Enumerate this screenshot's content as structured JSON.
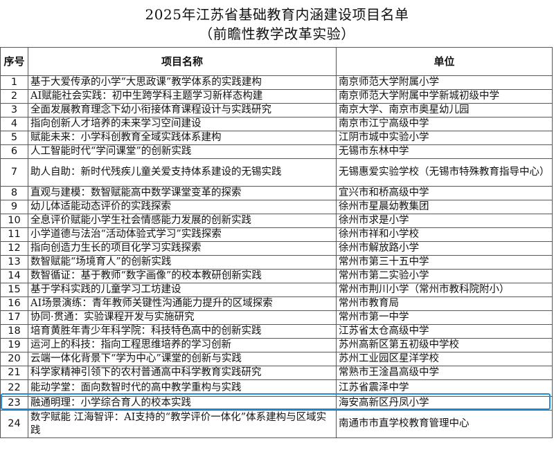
{
  "header": {
    "title": "2025年江苏省基础教育内涵建设项目名单",
    "subtitle": "（前瞻性教学改革实验）"
  },
  "table": {
    "columns": [
      "序号",
      "项目名称",
      "单位"
    ],
    "rows": [
      {
        "no": "1",
        "name": "基于大爱传承的小学“大思政课”教学体系的实践建构",
        "unit": "南京师范大学附属小学"
      },
      {
        "no": "2",
        "name": "AI赋能社会实践：初中生跨学科主题学习新样态构建",
        "unit": "南京师范大学附属中学新城初级中学"
      },
      {
        "no": "3",
        "name": "全面发展教育理念下幼小衔接体育课程设计与实践研究",
        "unit": "南京大学、南京市奥星幼儿园"
      },
      {
        "no": "4",
        "name": "指向创新人才培养的未来学习空间建设",
        "unit": "南京市江宁高级中学"
      },
      {
        "no": "5",
        "name": "赋能未来：小学科创教育全域实践体系建构",
        "unit": "江阴市城中实验小学"
      },
      {
        "no": "6",
        "name": "人工智能时代“学问课堂”的创新实践",
        "unit": "无锡市东林中学"
      },
      {
        "no": "7",
        "name": "助人自助：新时代残疾儿童关爱支持体系建设的无锡实践",
        "unit": "无锡惠爱实验学校（无锡市特殊教育指导中心）"
      },
      {
        "no": "8",
        "name": "直观与建模：数智赋能高中数学课堂变革的探索",
        "unit": "宜兴市和桥高级中学"
      },
      {
        "no": "9",
        "name": "幼儿体适能动态评价的实践探索",
        "unit": "徐州市星晨幼教集团"
      },
      {
        "no": "10",
        "name": "全息评价赋能小学生社会情感能力发展的创新实践",
        "unit": "徐州市求是小学"
      },
      {
        "no": "11",
        "name": "小学道德与法治“活动体验式学习”实践探索",
        "unit": "徐州市祥和小学校"
      },
      {
        "no": "12",
        "name": "指向创造力生长的项目化学习实践探索",
        "unit": "徐州市解放路小学"
      },
      {
        "no": "13",
        "name": "数智赋能“场境育人”的创新实践",
        "unit": "常州市第三十五中学"
      },
      {
        "no": "14",
        "name": "数智循证：基于教师“数字画像”的校本教研创新实践",
        "unit": "常州市第二实验小学"
      },
      {
        "no": "15",
        "name": "基于学科实践的儿童学习工坊建设",
        "unit": "常州市荆川小学（常州市教科院附小）"
      },
      {
        "no": "16",
        "name": "AI场景演练：青年教师关键性沟通能力提升的区域探索",
        "unit": "常州市教育局"
      },
      {
        "no": "17",
        "name": "协同·贯通：实验课程开发与实施研究",
        "unit": "常州市第一中学"
      },
      {
        "no": "18",
        "name": "培育黄胜年青少年科学院：科技特色高中的创新实践",
        "unit": "江苏省太仓高级中学"
      },
      {
        "no": "19",
        "name": "运河上的科技：指向工程思维培养的学习创新",
        "unit": "苏州高新区第五初级中学校"
      },
      {
        "no": "20",
        "name": "云端一体化背景下“学为中心”课堂的创新与实践",
        "unit": "苏州工业园区星洋学校"
      },
      {
        "no": "21",
        "name": "科学家精神引领下的农村普通高中科学教育实践研究",
        "unit": "常熟市王淦昌高级中学"
      },
      {
        "no": "22",
        "name": "能动学堂：面向数智时代的高中教学重构与实践",
        "unit": "江苏省震泽中学"
      },
      {
        "no": "23",
        "name": "融通明理：小学综合育人的校本实践",
        "unit": "海安高新区丹凤小学"
      },
      {
        "no": "24",
        "name": "数字赋能 江海智评：AI支持的“教学评价一体化”体系建构与区域实践",
        "unit": "南通市市直学校教育管理中心"
      }
    ]
  },
  "highlight_color": "#1e8fe0"
}
